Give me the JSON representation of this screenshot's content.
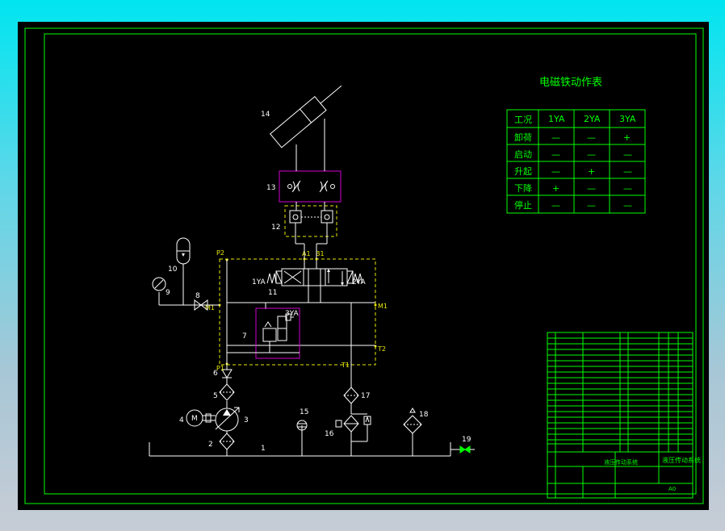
{
  "table": {
    "title": "电磁铁动作表",
    "headers": [
      "工况",
      "1YA",
      "2YA",
      "3YA"
    ],
    "rows": [
      [
        "卸荷",
        "—",
        "—",
        "+"
      ],
      [
        "启动",
        "—",
        "—",
        "—"
      ],
      [
        "升起",
        "—",
        "+",
        "—"
      ],
      [
        "下降",
        "+",
        "—",
        "—"
      ],
      [
        "停止",
        "—",
        "—",
        "—"
      ]
    ]
  },
  "components": {
    "n1": "1",
    "n2": "2",
    "n3": "3",
    "n4": "4",
    "n5": "5",
    "n6": "6",
    "n7": "7",
    "n8": "8",
    "n9": "9",
    "n10": "10",
    "n11": "11",
    "n12": "12",
    "n13": "13",
    "n14": "14",
    "n15": "15",
    "n16": "16",
    "n17": "17",
    "n18": "18",
    "n19": "19",
    "motor": "M",
    "sol1": "1YA",
    "sol2": "2YA",
    "sol3": "3YA"
  },
  "ports": {
    "p2": "P2",
    "a1": "A1",
    "b1": "B1",
    "m1_left": "M1",
    "m1_right": "M1",
    "p1": "P1",
    "t1": "T1",
    "t2": "T2"
  },
  "title_block": {
    "drawing_title": "液压传动系统",
    "scale": "A0"
  },
  "colors": {
    "lines": "#ffffff",
    "frame": "#00ff00",
    "pipes": "#e8e800",
    "valves": "#d000d0"
  }
}
